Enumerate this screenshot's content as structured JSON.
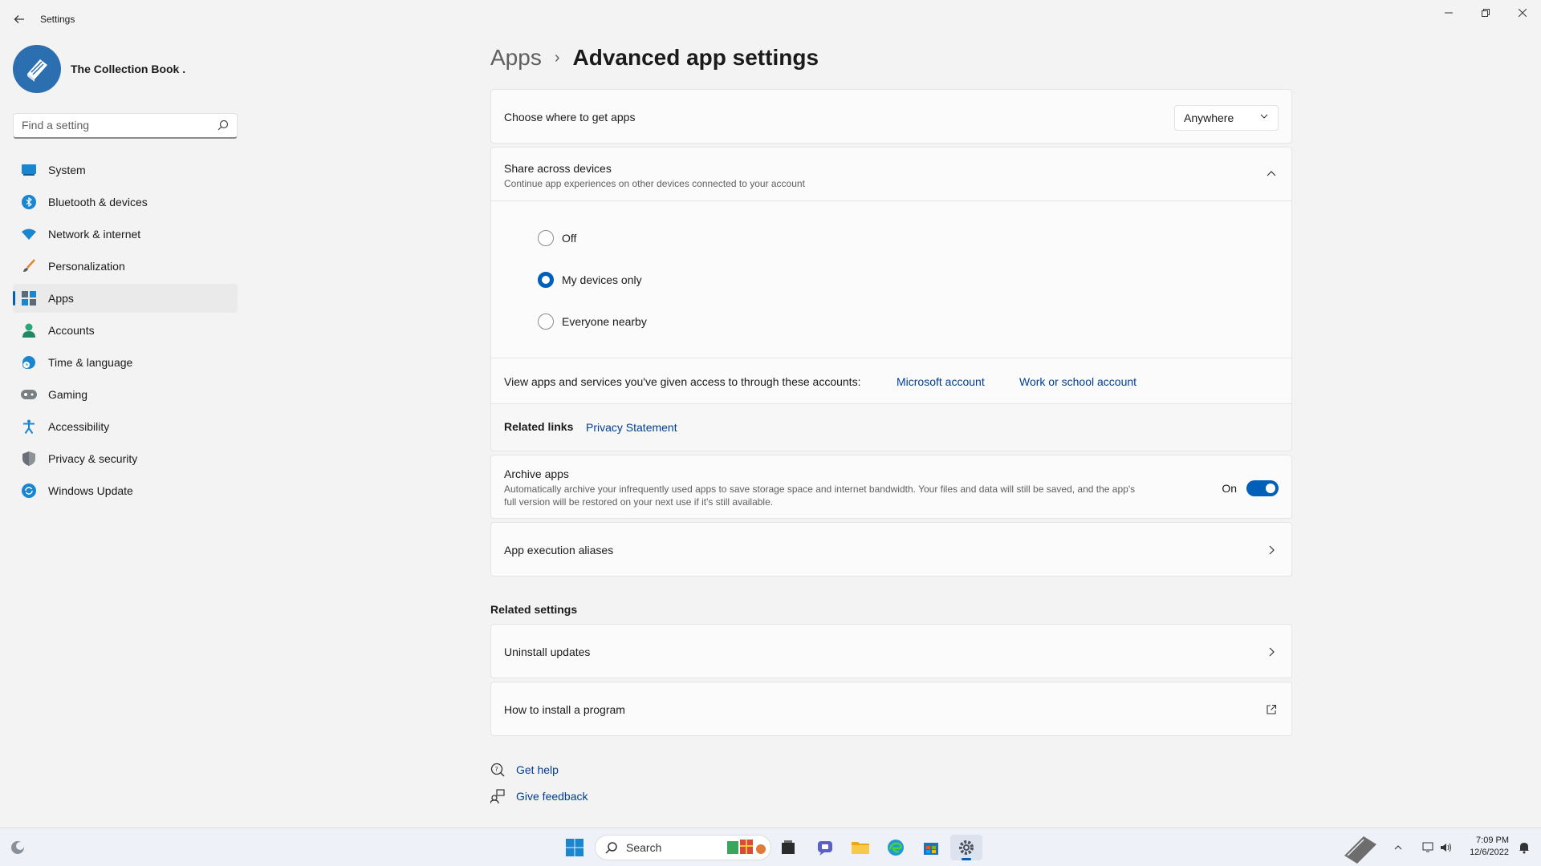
{
  "window": {
    "title": "Settings"
  },
  "profile": {
    "name": "The Collection Book ."
  },
  "search": {
    "placeholder": "Find a setting"
  },
  "nav": {
    "items": [
      {
        "id": "system",
        "label": "System",
        "active": false
      },
      {
        "id": "bluetooth",
        "label": "Bluetooth & devices",
        "active": false
      },
      {
        "id": "network",
        "label": "Network & internet",
        "active": false
      },
      {
        "id": "personalization",
        "label": "Personalization",
        "active": false
      },
      {
        "id": "apps",
        "label": "Apps",
        "active": true
      },
      {
        "id": "accounts",
        "label": "Accounts",
        "active": false
      },
      {
        "id": "time",
        "label": "Time & language",
        "active": false
      },
      {
        "id": "gaming",
        "label": "Gaming",
        "active": false
      },
      {
        "id": "accessibility",
        "label": "Accessibility",
        "active": false
      },
      {
        "id": "privacy",
        "label": "Privacy & security",
        "active": false
      },
      {
        "id": "update",
        "label": "Windows Update",
        "active": false
      }
    ]
  },
  "breadcrumb": {
    "parent": "Apps",
    "separator": "›",
    "current": "Advanced app settings"
  },
  "get_apps": {
    "label": "Choose where to get apps",
    "selected": "Anywhere"
  },
  "share": {
    "title": "Share across devices",
    "subtitle": "Continue app experiences on other devices connected to your account",
    "options": [
      {
        "label": "Off",
        "checked": false
      },
      {
        "label": "My devices only",
        "checked": true
      },
      {
        "label": "Everyone nearby",
        "checked": false
      }
    ],
    "accounts_text": "View apps and services you've given access to through these accounts:",
    "microsoft_account": "Microsoft account",
    "work_account": "Work or school account",
    "related_links_label": "Related links",
    "privacy_statement": "Privacy Statement"
  },
  "archive": {
    "title": "Archive apps",
    "subtitle": "Automatically archive your infrequently used apps to save storage space and internet bandwidth. Your files and data will still be saved, and the app's full version will be restored on your next use if it's still available.",
    "state_label": "On",
    "enabled": true
  },
  "aliases": {
    "label": "App execution aliases"
  },
  "related_settings": {
    "title": "Related settings",
    "uninstall_updates": "Uninstall updates",
    "install_program": "How to install a program"
  },
  "help": {
    "get_help": "Get help",
    "give_feedback": "Give feedback"
  },
  "taskbar": {
    "search_label": "Search",
    "time": "7:09 PM",
    "date": "12/6/2022"
  },
  "colors": {
    "accent": "#005fb8",
    "link": "#003e92"
  }
}
